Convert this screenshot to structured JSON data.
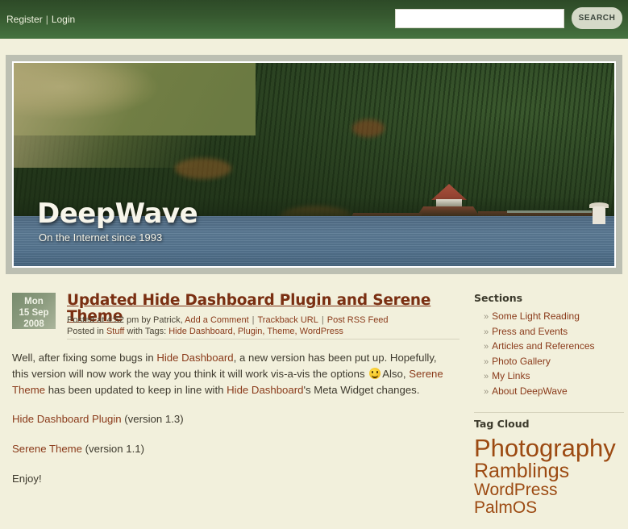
{
  "topbar": {
    "register_label": "Register",
    "separator": "|",
    "login_label": "Login",
    "search_value": "",
    "search_placeholder": "",
    "search_button_label": "SEARCH"
  },
  "banner": {
    "title": "DeepWave",
    "tagline": "On the Internet since 1993"
  },
  "post": {
    "date": {
      "weekday": "Mon",
      "daymonth": "15 Sep",
      "year": "2008"
    },
    "title": "Updated Hide Dashboard Plugin and Serene Theme",
    "meta1": {
      "posted_time": "Posted at 4:52 pm by Patrick,",
      "add_comment": "Add a Comment",
      "div1": "|",
      "trackback": "Trackback URL",
      "div2": "|",
      "rss": "Post RSS Feed"
    },
    "meta2": {
      "prefix": "Posted in",
      "category": "Stuff",
      "with_tags": "with Tags:",
      "tags": "Hide Dashboard, Plugin, Theme, WordPress"
    },
    "body": {
      "p1_a": "Well, after fixing some bugs in ",
      "p1_link1": "Hide Dashboard",
      "p1_b": ", a new version has been put up. Hopefully, this version will now work the way you think it will work vis-a-vis the options ",
      "p1_c": "Also, ",
      "p1_link2": "Serene Theme",
      "p1_d": " has been updated to keep in line with ",
      "p1_link3": "Hide Dashboard",
      "p1_e": "'s Meta Widget changes.",
      "link_line1_a": "Hide Dashboard Plugin",
      "link_line1_b": " (version 1.3)",
      "link_line2_a": "Serene Theme",
      "link_line2_b": " (version 1.1)",
      "closing": "Enjoy!"
    }
  },
  "sidebar": {
    "sections": {
      "title": "Sections",
      "bullet": "»",
      "items": [
        {
          "label": "Some Light Reading"
        },
        {
          "label": "Press and Events"
        },
        {
          "label": "Articles and References"
        },
        {
          "label": "Photo Gallery"
        },
        {
          "label": "My Links"
        },
        {
          "label": "About DeepWave"
        }
      ]
    },
    "tag_cloud": {
      "title": "Tag Cloud",
      "tags": [
        {
          "label": "Photography",
          "size": "xl"
        },
        {
          "label": "Ramblings",
          "size": "lg"
        },
        {
          "label": "WordPress",
          "size": "md"
        },
        {
          "label": "PalmOS",
          "size": "md"
        }
      ]
    }
  },
  "colors": {
    "header_green_top": "#2d4a27",
    "header_green_bottom": "#457340",
    "page_bg": "#f2f0dc",
    "banner_frame": "#bcbfb2",
    "link_brown": "#8a3a1a",
    "title_brown": "#7a2f12",
    "tag_orange": "#9c4a12"
  }
}
